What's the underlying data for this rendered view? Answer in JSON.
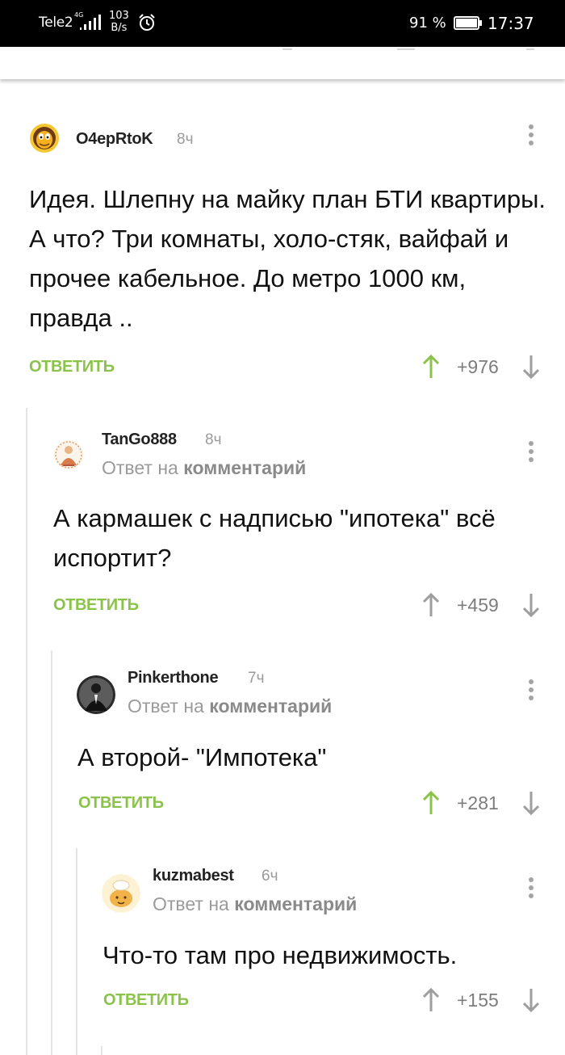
{
  "status_bar": {
    "carrier": "Tele2",
    "network": "4G",
    "speed_value": "103",
    "speed_unit": "B/s",
    "battery": "91 %",
    "time": "17:37",
    "icons": [
      "signal-icon",
      "alarm-icon",
      "battery-icon"
    ]
  },
  "colors": {
    "reply_accent": "#8bc34a",
    "upvote_active": "#8bc34a",
    "vote_neutral": "#9e9e9e",
    "muted_text": "#9b9b9b"
  },
  "comments": [
    {
      "username": "O4epRtoK",
      "time": "8ч",
      "reply_prefix": "",
      "reply_target": "",
      "text": "Идея. Шлепну на майку план БТИ квартиры. А что? Три комнаты, холо-стяк, вайфай и прочее кабельное. До метро 1000 км, правда ..",
      "reply_label": "ОТВЕТИТЬ",
      "rating": "+976",
      "upvoted": true
    },
    {
      "username": "TanGo888",
      "time": "8ч",
      "reply_prefix": "Ответ на",
      "reply_target": "комментарий",
      "text": "А кармашек с надписью \"ипотека\" всё испортит?",
      "reply_label": "ОТВЕТИТЬ",
      "rating": "+459",
      "upvoted": false
    },
    {
      "username": "Pinkerthone",
      "time": "7ч",
      "reply_prefix": "Ответ на",
      "reply_target": "комментарий",
      "text": "А второй- \"Импотека\"",
      "reply_label": "ОТВЕТИТЬ",
      "rating": "+281",
      "upvoted": true
    },
    {
      "username": "kuzmabest",
      "time": "6ч",
      "reply_prefix": "Ответ на",
      "reply_target": "комментарий",
      "text": "Что-то там про недвижимость.",
      "reply_label": "ОТВЕТИТЬ",
      "rating": "+155",
      "upvoted": false
    }
  ]
}
